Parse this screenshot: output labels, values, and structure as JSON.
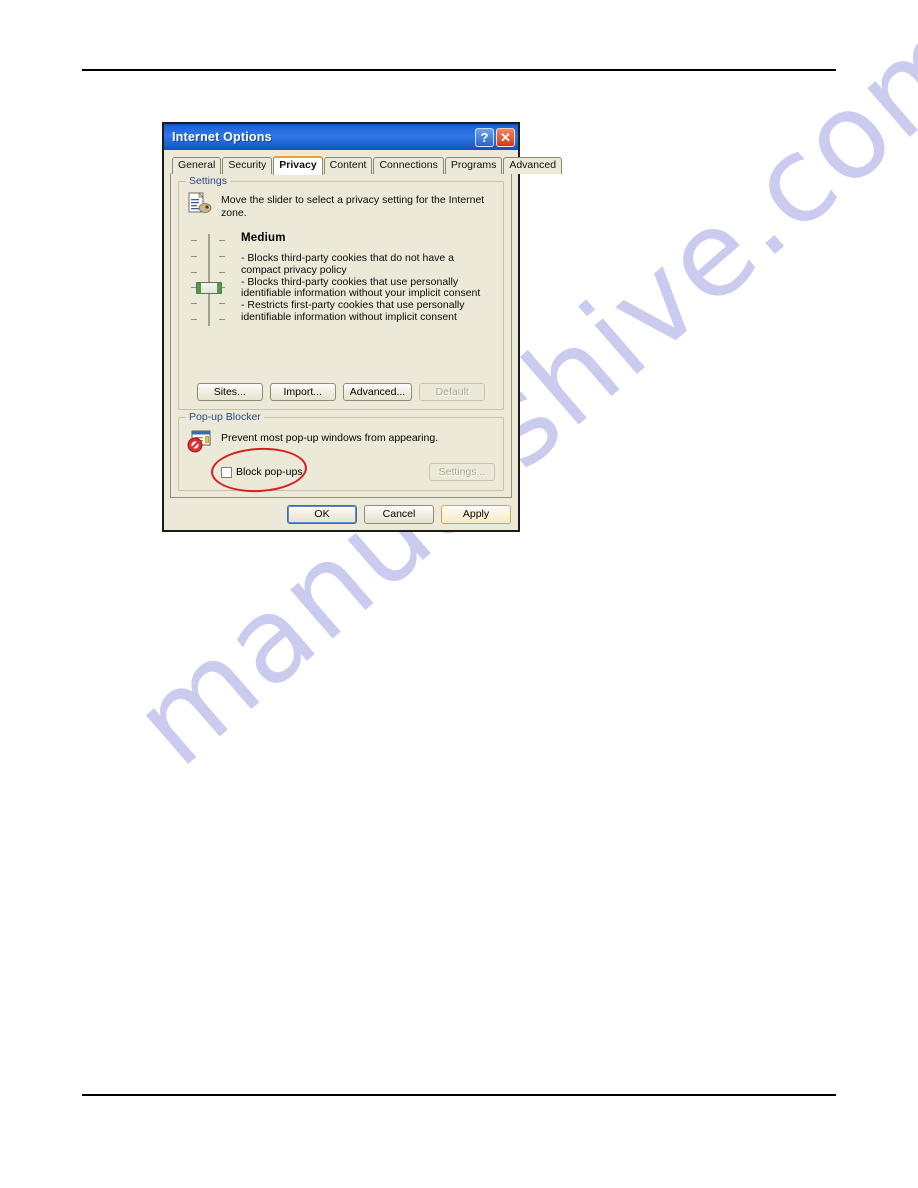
{
  "document": {
    "watermark": "manualshive.com",
    "watermark_color": "#c8c9ef",
    "rule_color": "#000000"
  },
  "dialog": {
    "title": "Internet Options",
    "titlebar_color": "#2f77e8",
    "face_color": "#ece9d8",
    "buttons": {
      "help": "?",
      "close": "✕"
    },
    "tabs": [
      {
        "label": "General",
        "active": false
      },
      {
        "label": "Security",
        "active": false
      },
      {
        "label": "Privacy",
        "active": true
      },
      {
        "label": "Content",
        "active": false
      },
      {
        "label": "Connections",
        "active": false
      },
      {
        "label": "Programs",
        "active": false
      },
      {
        "label": "Advanced",
        "active": false
      }
    ],
    "active_tab_accent": "#f2a127",
    "settings_group": {
      "legend": "Settings",
      "icon": "privacy-document-icon",
      "intro": "Move the slider to select a privacy setting for the Internet zone.",
      "slider": {
        "level_count": 6,
        "thumb_position_label": "Medium"
      },
      "level_title": "Medium",
      "level_bullets": [
        "- Blocks third-party cookies that do not have a compact privacy policy",
        "- Blocks third-party cookies that use personally identifiable information without your implicit consent",
        "- Restricts first-party cookies that use personally identifiable information without implicit consent"
      ],
      "buttons": [
        {
          "label": "Sites...",
          "disabled": false
        },
        {
          "label": "Import...",
          "disabled": false
        },
        {
          "label": "Advanced...",
          "disabled": false
        },
        {
          "label": "Default",
          "disabled": true
        }
      ]
    },
    "popup_group": {
      "legend": "Pop-up Blocker",
      "icon": "popup-blocked-icon",
      "description": "Prevent most pop-up windows from appearing.",
      "checkbox": {
        "label": "Block pop-ups",
        "checked": false
      },
      "settings_button": {
        "label": "Settings...",
        "disabled": true
      }
    },
    "footer_buttons": [
      {
        "label": "OK",
        "style": "default"
      },
      {
        "label": "Cancel",
        "style": "normal"
      },
      {
        "label": "Apply",
        "style": "hot"
      }
    ]
  },
  "annotation": {
    "type": "ellipse",
    "color": "#d81f1f",
    "targets": "block-pop-ups-checkbox"
  }
}
